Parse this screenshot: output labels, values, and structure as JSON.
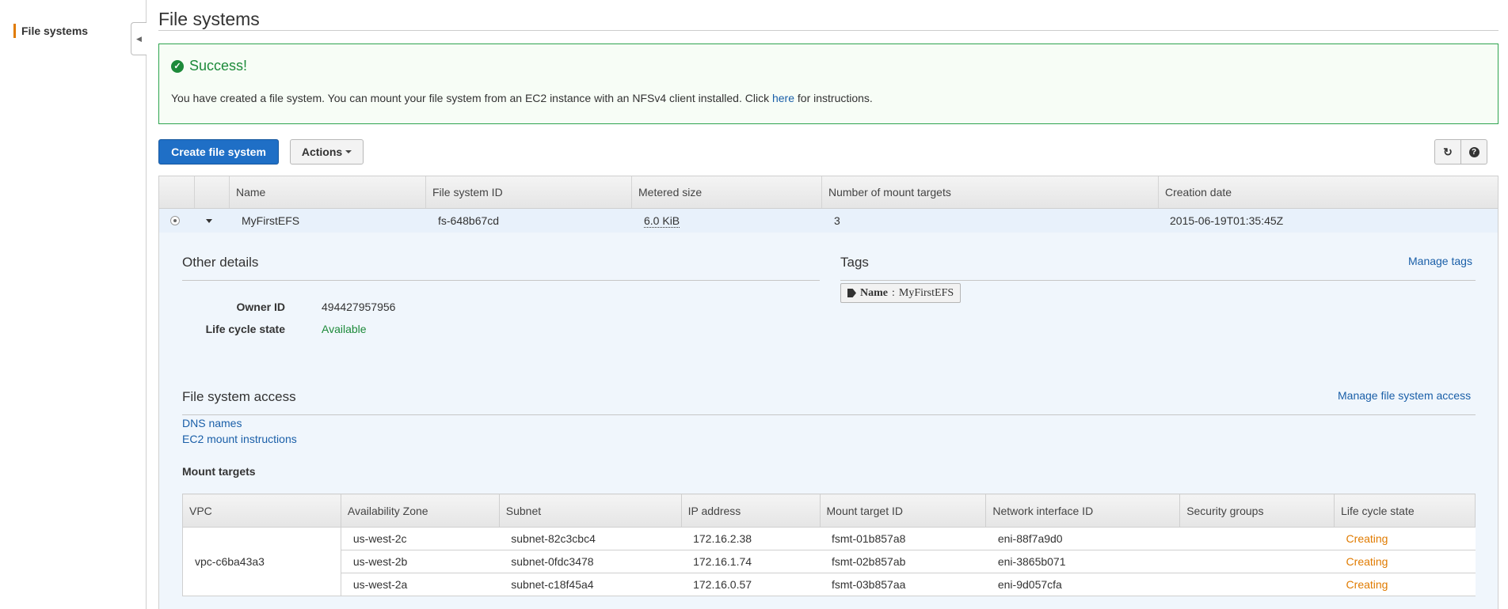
{
  "sidebar": {
    "item": "File systems"
  },
  "page": {
    "title": "File systems"
  },
  "alert": {
    "heading": "Success!",
    "message_before": "You have created a file system. You can mount your file system from an EC2 instance with an NFSv4 client installed. Click ",
    "link": "here",
    "message_after": " for instructions."
  },
  "toolbar": {
    "create_label": "Create file system",
    "actions_label": "Actions",
    "refresh_icon": "refresh-icon",
    "help_icon": "help-icon"
  },
  "fs_table": {
    "headers": [
      "Name",
      "File system ID",
      "Metered size",
      "Number of mount targets",
      "Creation date"
    ],
    "row": {
      "name": "MyFirstEFS",
      "id": "fs-648b67cd",
      "size": "6.0 KiB",
      "mount_targets": "3",
      "created": "2015-06-19T01:35:45Z"
    }
  },
  "details": {
    "other_title": "Other details",
    "owner_label": "Owner ID",
    "owner_value": "494427957956",
    "lifecycle_label": "Life cycle state",
    "lifecycle_value": "Available",
    "tags_title": "Tags",
    "manage_tags": "Manage tags",
    "tag_key": "Name",
    "tag_sep": ": ",
    "tag_value": "MyFirstEFS",
    "access_title": "File system access",
    "manage_access": "Manage file system access",
    "dns_link": "DNS names",
    "ec2_link": "EC2 mount instructions",
    "mount_title": "Mount targets"
  },
  "mount_table": {
    "headers": [
      "VPC",
      "Availability Zone",
      "Subnet",
      "IP address",
      "Mount target ID",
      "Network interface ID",
      "Security groups",
      "Life cycle state"
    ],
    "vpc": "vpc-c6ba43a3",
    "rows": [
      {
        "az": "us-west-2c",
        "subnet": "subnet-82c3cbc4",
        "ip": "172.16.2.38",
        "mt": "fsmt-01b857a8",
        "eni": "eni-88f7a9d0",
        "sg": "",
        "state": "Creating"
      },
      {
        "az": "us-west-2b",
        "subnet": "subnet-0fdc3478",
        "ip": "172.16.1.74",
        "mt": "fsmt-02b857ab",
        "eni": "eni-3865b071",
        "sg": "",
        "state": "Creating"
      },
      {
        "az": "us-west-2a",
        "subnet": "subnet-c18f45a4",
        "ip": "172.16.0.57",
        "mt": "fsmt-03b857aa",
        "eni": "eni-9d057cfa",
        "sg": "",
        "state": "Creating"
      }
    ]
  }
}
